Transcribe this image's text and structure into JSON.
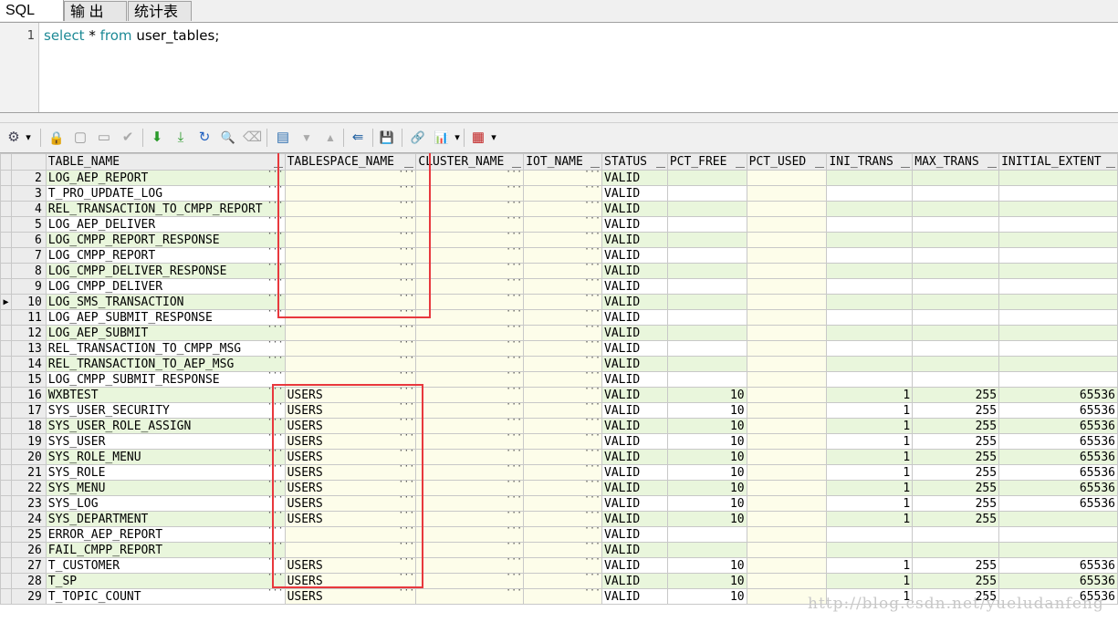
{
  "tabs": [
    {
      "label": "SQL"
    },
    {
      "label": "输 出"
    },
    {
      "label": "统计表"
    }
  ],
  "editor": {
    "line_number": "1",
    "kw1": "select",
    "mid": " * ",
    "kw2": "from",
    "rest": " user_tables;"
  },
  "icons": {
    "settings": "⚙",
    "dropdown": "▾",
    "lock": "🔒",
    "grid_add": "▢",
    "grid_del": "▭",
    "check": "✔",
    "fetch_next": "⬇",
    "fetch_last": "⤓",
    "refresh": "↻",
    "find": "🔍",
    "clear": "⌫",
    "query_by_example": "▤",
    "next": "▼",
    "prev": "▲",
    "export": "⇚",
    "save": "💾",
    "link": "🔗",
    "chart": "📊",
    "table_view": "▦"
  },
  "columns": [
    "TABLE_NAME",
    "TABLESPACE_NAME",
    "CLUSTER_NAME",
    "IOT_NAME",
    "STATUS",
    "PCT_FREE",
    "PCT_USED",
    "INI_TRANS",
    "MAX_TRANS",
    "INITIAL_EXTENT"
  ],
  "rows": [
    {
      "n": "2",
      "name": "LOG_AEP_REPORT",
      "ts": "",
      "status": "VALID",
      "pf": "",
      "it": "",
      "mt": "",
      "ie": ""
    },
    {
      "n": "3",
      "name": "T_PRO_UPDATE_LOG",
      "ts": "",
      "status": "VALID",
      "pf": "",
      "it": "",
      "mt": "",
      "ie": ""
    },
    {
      "n": "4",
      "name": "REL_TRANSACTION_TO_CMPP_REPORT",
      "ts": "",
      "status": "VALID",
      "pf": "",
      "it": "",
      "mt": "",
      "ie": ""
    },
    {
      "n": "5",
      "name": "LOG_AEP_DELIVER",
      "ts": "",
      "status": "VALID",
      "pf": "",
      "it": "",
      "mt": "",
      "ie": ""
    },
    {
      "n": "6",
      "name": "LOG_CMPP_REPORT_RESPONSE",
      "ts": "",
      "status": "VALID",
      "pf": "",
      "it": "",
      "mt": "",
      "ie": ""
    },
    {
      "n": "7",
      "name": "LOG_CMPP_REPORT",
      "ts": "",
      "status": "VALID",
      "pf": "",
      "it": "",
      "mt": "",
      "ie": ""
    },
    {
      "n": "8",
      "name": "LOG_CMPP_DELIVER_RESPONSE",
      "ts": "",
      "status": "VALID",
      "pf": "",
      "it": "",
      "mt": "",
      "ie": ""
    },
    {
      "n": "9",
      "name": "LOG_CMPP_DELIVER",
      "ts": "",
      "status": "VALID",
      "pf": "",
      "it": "",
      "mt": "",
      "ie": ""
    },
    {
      "n": "10",
      "name": "LOG_SMS_TRANSACTION",
      "ts": "",
      "status": "VALID",
      "pf": "",
      "it": "",
      "mt": "",
      "ie": "",
      "current": true
    },
    {
      "n": "11",
      "name": "LOG_AEP_SUBMIT_RESPONSE",
      "ts": "",
      "status": "VALID",
      "pf": "",
      "it": "",
      "mt": "",
      "ie": ""
    },
    {
      "n": "12",
      "name": "LOG_AEP_SUBMIT",
      "ts": "",
      "status": "VALID",
      "pf": "",
      "it": "",
      "mt": "",
      "ie": ""
    },
    {
      "n": "13",
      "name": "REL_TRANSACTION_TO_CMPP_MSG",
      "ts": "",
      "status": "VALID",
      "pf": "",
      "it": "",
      "mt": "",
      "ie": ""
    },
    {
      "n": "14",
      "name": "REL_TRANSACTION_TO_AEP_MSG",
      "ts": "",
      "status": "VALID",
      "pf": "",
      "it": "",
      "mt": "",
      "ie": ""
    },
    {
      "n": "15",
      "name": "LOG_CMPP_SUBMIT_RESPONSE",
      "ts": "",
      "status": "VALID",
      "pf": "",
      "it": "",
      "mt": "",
      "ie": ""
    },
    {
      "n": "16",
      "name": "WXBTEST",
      "ts": "USERS",
      "status": "VALID",
      "pf": "10",
      "it": "1",
      "mt": "255",
      "ie": "65536"
    },
    {
      "n": "17",
      "name": "SYS_USER_SECURITY",
      "ts": "USERS",
      "status": "VALID",
      "pf": "10",
      "it": "1",
      "mt": "255",
      "ie": "65536"
    },
    {
      "n": "18",
      "name": "SYS_USER_ROLE_ASSIGN",
      "ts": "USERS",
      "status": "VALID",
      "pf": "10",
      "it": "1",
      "mt": "255",
      "ie": "65536"
    },
    {
      "n": "19",
      "name": "SYS_USER",
      "ts": "USERS",
      "status": "VALID",
      "pf": "10",
      "it": "1",
      "mt": "255",
      "ie": "65536"
    },
    {
      "n": "20",
      "name": "SYS_ROLE_MENU",
      "ts": "USERS",
      "status": "VALID",
      "pf": "10",
      "it": "1",
      "mt": "255",
      "ie": "65536"
    },
    {
      "n": "21",
      "name": "SYS_ROLE",
      "ts": "USERS",
      "status": "VALID",
      "pf": "10",
      "it": "1",
      "mt": "255",
      "ie": "65536"
    },
    {
      "n": "22",
      "name": "SYS_MENU",
      "ts": "USERS",
      "status": "VALID",
      "pf": "10",
      "it": "1",
      "mt": "255",
      "ie": "65536"
    },
    {
      "n": "23",
      "name": "SYS_LOG",
      "ts": "USERS",
      "status": "VALID",
      "pf": "10",
      "it": "1",
      "mt": "255",
      "ie": "65536"
    },
    {
      "n": "24",
      "name": "SYS_DEPARTMENT",
      "ts": "USERS",
      "status": "VALID",
      "pf": "10",
      "it": "1",
      "mt": "255",
      "ie": ""
    },
    {
      "n": "25",
      "name": "ERROR_AEP_REPORT",
      "ts": "",
      "status": "VALID",
      "pf": "",
      "it": "",
      "mt": "",
      "ie": ""
    },
    {
      "n": "26",
      "name": "FAIL_CMPP_REPORT",
      "ts": "",
      "status": "VALID",
      "pf": "",
      "it": "",
      "mt": "",
      "ie": ""
    },
    {
      "n": "27",
      "name": "T_CUSTOMER",
      "ts": "USERS",
      "status": "VALID",
      "pf": "10",
      "it": "1",
      "mt": "255",
      "ie": "65536"
    },
    {
      "n": "28",
      "name": "T_SP",
      "ts": "USERS",
      "status": "VALID",
      "pf": "10",
      "it": "1",
      "mt": "255",
      "ie": "65536"
    },
    {
      "n": "29",
      "name": "T_TOPIC_COUNT",
      "ts": "USERS",
      "status": "VALID",
      "pf": "10",
      "it": "1",
      "mt": "255",
      "ie": "65536"
    }
  ],
  "watermark": "http://blog.csdn.net/yueludanfeng"
}
